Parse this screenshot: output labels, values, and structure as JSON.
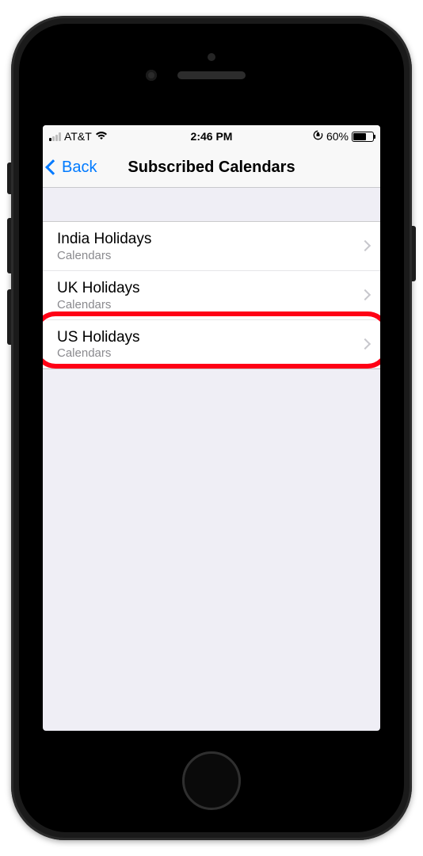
{
  "status": {
    "carrier": "AT&T",
    "time": "2:46 PM",
    "battery_pct": "60%"
  },
  "nav": {
    "back_label": "Back",
    "title": "Subscribed Calendars"
  },
  "list": {
    "items": [
      {
        "title": "India Holidays",
        "subtitle": "Calendars"
      },
      {
        "title": "UK Holidays",
        "subtitle": "Calendars"
      },
      {
        "title": "US Holidays",
        "subtitle": "Calendars"
      }
    ]
  },
  "annotation": {
    "highlighted_index": 2
  }
}
